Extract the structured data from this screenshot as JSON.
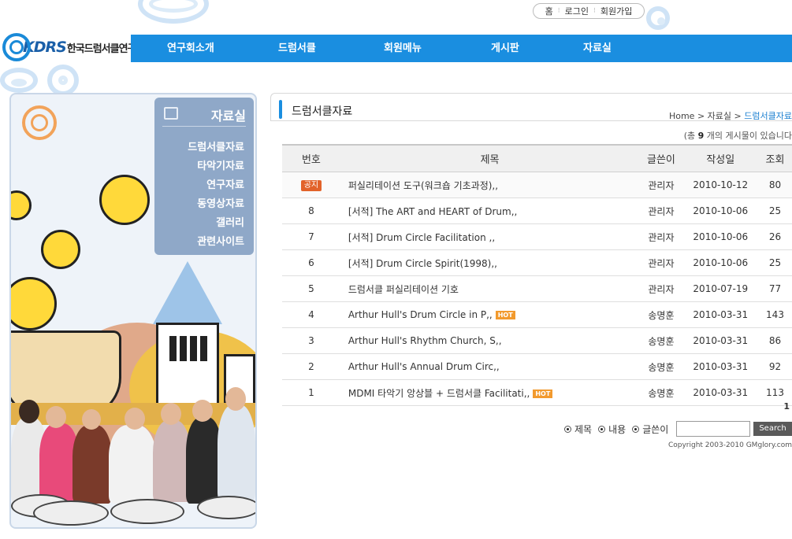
{
  "util": {
    "home": "홈",
    "login": "로그인",
    "join": "회원가입"
  },
  "logo": {
    "kdrs": "KDRS",
    "name": "한국드럼서클연구회"
  },
  "nav": [
    "연구회소개",
    "드럼서클",
    "회원메뉴",
    "게시판",
    "자료실"
  ],
  "side": {
    "title": "자료실",
    "items": [
      "드럼서클자료",
      "타악기자료",
      "연구자료",
      "동영상자료",
      "갤러리",
      "관련사이트"
    ]
  },
  "board": {
    "title": "드럼서클자료",
    "breadcrumb": {
      "home": "Home",
      "sep": ">",
      "section": "자료실",
      "current": "드럼서클자료"
    },
    "total_prefix": "(총",
    "total_count": "9",
    "total_suffix": "개의 게시물이 있습니다",
    "columns": [
      "번호",
      "제목",
      "글쓴이",
      "작성일",
      "조회"
    ],
    "rows": [
      {
        "no": "공지",
        "notice": true,
        "subject": "퍼실리테이션 도구(워크숍 기초과정),,",
        "hot": false,
        "author": "관리자",
        "date": "2010-10-12",
        "views": "80"
      },
      {
        "no": "8",
        "notice": false,
        "subject": "[서적] The ART and HEART of Drum,,",
        "hot": false,
        "author": "관리자",
        "date": "2010-10-06",
        "views": "25"
      },
      {
        "no": "7",
        "notice": false,
        "subject": "[서적] Drum Circle Facilitation ,,",
        "hot": false,
        "author": "관리자",
        "date": "2010-10-06",
        "views": "26"
      },
      {
        "no": "6",
        "notice": false,
        "subject": "[서적] Drum Circle Spirit(1998),,",
        "hot": false,
        "author": "관리자",
        "date": "2010-10-06",
        "views": "25"
      },
      {
        "no": "5",
        "notice": false,
        "subject": "드럼서클 퍼실리테이션 기호",
        "hot": false,
        "author": "관리자",
        "date": "2010-07-19",
        "views": "77"
      },
      {
        "no": "4",
        "notice": false,
        "subject": "Arthur Hull's Drum Circle in P,,",
        "hot": true,
        "author": "송명훈",
        "date": "2010-03-31",
        "views": "143"
      },
      {
        "no": "3",
        "notice": false,
        "subject": "Arthur Hull's Rhythm Church, S,,",
        "hot": false,
        "author": "송명훈",
        "date": "2010-03-31",
        "views": "86"
      },
      {
        "no": "2",
        "notice": false,
        "subject": "Arthur Hull's Annual Drum Circ,,",
        "hot": false,
        "author": "송명훈",
        "date": "2010-03-31",
        "views": "92"
      },
      {
        "no": "1",
        "notice": false,
        "subject": "MDMI 타악기 앙상블 + 드럼서클 Facilitati,,",
        "hot": true,
        "author": "송명훈",
        "date": "2010-03-31",
        "views": "113"
      }
    ],
    "hot_label": "HOT",
    "page": "1"
  },
  "search": {
    "opt_subject": "제목",
    "opt_content": "내용",
    "opt_author": "글쓴이",
    "button": "Search"
  },
  "copyright": "Copyright 2003-2010 GMglory.com",
  "colors": {
    "nav": "#1a8ee0",
    "side_menu": "#8fa8c8",
    "notice_badge": "#e2622a",
    "hot_badge": "#f29a2e"
  }
}
